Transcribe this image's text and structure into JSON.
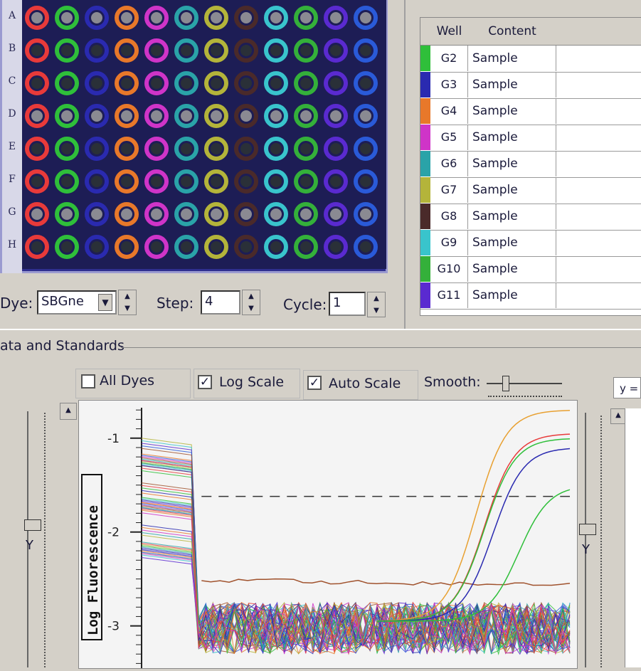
{
  "plate": {
    "rows": [
      "A",
      "B",
      "C",
      "D",
      "E",
      "F",
      "G",
      "H"
    ],
    "column_colors": [
      "#e83a3a",
      "#2fbf3a",
      "#2a2ab0",
      "#e8782a",
      "#cf34c8",
      "#2aa3a8",
      "#b4b43a",
      "#4a2a2a",
      "#39c4cc",
      "#34b03a",
      "#5a2ad0",
      "#2a5ad8"
    ]
  },
  "well_table": {
    "headers": [
      "Well",
      "Content"
    ],
    "rows": [
      {
        "well": "G2",
        "content": "Sample",
        "color": "#2fbf3a"
      },
      {
        "well": "G3",
        "content": "Sample",
        "color": "#2a2ab0"
      },
      {
        "well": "G4",
        "content": "Sample",
        "color": "#e8782a"
      },
      {
        "well": "G5",
        "content": "Sample",
        "color": "#cf34c8"
      },
      {
        "well": "G6",
        "content": "Sample",
        "color": "#2aa3a8"
      },
      {
        "well": "G7",
        "content": "Sample",
        "color": "#b4b43a"
      },
      {
        "well": "G8",
        "content": "Sample",
        "color": "#4a2a2a"
      },
      {
        "well": "G9",
        "content": "Sample",
        "color": "#39c4cc"
      },
      {
        "well": "G10",
        "content": "Sample",
        "color": "#34b03a"
      },
      {
        "well": "G11",
        "content": "Sample",
        "color": "#5a2ad0"
      }
    ]
  },
  "controls": {
    "dye_label": "Dye:",
    "dye_value": "SBGne",
    "step_label": "Step:",
    "step_value": "4",
    "cycle_label": "Cycle:",
    "cycle_value": "1"
  },
  "section": {
    "title": "ata and Standards"
  },
  "options": {
    "all_dyes": "All Dyes",
    "log_scale": "Log Scale",
    "auto_scale": "Auto Scale",
    "smooth": "Smooth:",
    "all_dyes_checked": false,
    "log_scale_checked": true,
    "auto_scale_checked": true,
    "y_equals": "y ="
  },
  "sliders": {
    "left_label": "Y",
    "right_label": "Y"
  },
  "chart_data": {
    "type": "line",
    "ylabel": "Log Fluorescence",
    "yticks": [
      -1,
      -2,
      -3
    ],
    "ylim": [
      -3.45,
      -0.6
    ],
    "xlim": [
      0,
      1
    ],
    "threshold": -1.62,
    "grid": false,
    "series_colors": [
      "#e83a3a",
      "#2fbf3a",
      "#2a2ab0",
      "#e8782a",
      "#cf34c8",
      "#2aa3a8",
      "#b4b43a",
      "#39c4cc",
      "#5a2ad0",
      "#2a5ad8",
      "#a0522d"
    ]
  }
}
